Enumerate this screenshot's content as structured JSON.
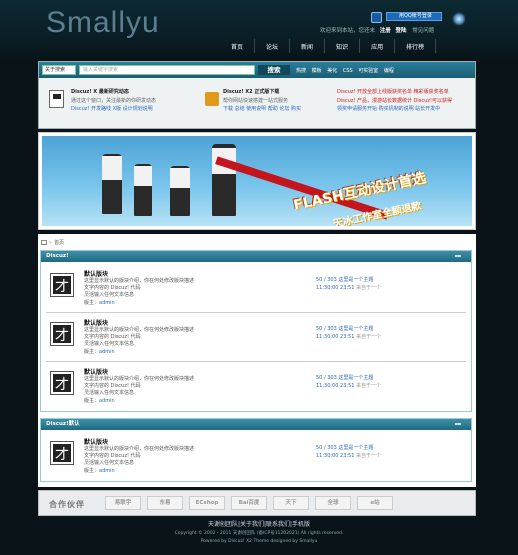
{
  "site": {
    "logo": "Smallyu"
  },
  "userbar": {
    "welcome": "欢迎来到本站，您还未",
    "register": "注册",
    "login": "登陆",
    "faq": "常见问题"
  },
  "qq_login_label": "用QQ帐号登录",
  "nav": [
    "首页",
    "论坛",
    "新闻",
    "知识",
    "应用",
    "排行榜"
  ],
  "search": {
    "scope": "关于搜索",
    "placeholder": "输入关键字搜索",
    "button": "搜索",
    "hot_words": [
      "热搜",
      "模板",
      "美化",
      "CSS",
      "可实验室",
      "编程"
    ]
  },
  "news": {
    "col1": {
      "title": "Discuz! X 最新研究动态",
      "line2": "通过这个窗口，关注最新的你研发动态",
      "line3": "Discuz! 开发路线 X版  设计规划说明"
    },
    "col2": {
      "title": "Discuz! X2 正式版下载",
      "line2": "帮你网站快速搭建一站式服务",
      "line3": "下载  总结  使用说明  帮助  论坛  购买"
    },
    "col3": {
      "line1": "Discuz! 开放全部上线版获奖名单  精彩版获奖名单",
      "line2": "Discuz! 产品，漫游站长数据统计  Discuz!可以获得",
      "line3": "领奖申请服务开始  购买机制的说明  站长开发中"
    }
  },
  "banner": {
    "headline": "FLASH互动设计首选",
    "subline": "天冰工作室全额退款"
  },
  "breadcrumb": {
    "arrow": "»",
    "home": "首页"
  },
  "sections": [
    {
      "title": "Discuz!",
      "forums": [
        {
          "name": "默认版块",
          "desc1": "这里显示默认的版块介绍，你在何处修改版块描述",
          "desc2": "文字内容的 Discuz! 代码",
          "desc3": "灵活输入任何文本信息",
          "mod_label": "版主：",
          "mod": "admin",
          "stats": "50 / 303 ",
          "stats_link": "这里是一个主题",
          "time": "11:30:00 23:51 ",
          "time_by": "来自于一个",
          "time_by2": ""
        },
        {
          "name": "默认版块",
          "desc1": "这里显示默认的版块介绍，你在何处修改版块描述",
          "desc2": "文字内容的 Discuz! 代码",
          "desc3": "灵活输入任何文本信息",
          "mod_label": "版主：",
          "mod": "admin",
          "stats": "50 / 303 ",
          "stats_link": "这里是一个主题",
          "time": "11:30:00 23:51 ",
          "time_by": "来自于一个",
          "time_by2": ""
        },
        {
          "name": "默认版块",
          "desc1": "这里显示默认的版块介绍，你在何处修改版块描述",
          "desc2": "文字内容的 Discuz! 代码",
          "desc3": "灵活输入任何文本信息",
          "mod_label": "版主：",
          "mod": "admin",
          "stats": "50 / 303 ",
          "stats_link": "这里是一个主题",
          "time": "11:30:00 23:51 ",
          "time_by": "来自于一个",
          "time_by2": ""
        }
      ]
    },
    {
      "title": "Discuz!默认",
      "forums": [
        {
          "name": "默认版块",
          "desc1": "这里显示默认的版块介绍，你在何处修改版块描述",
          "desc2": "文字内容的 Discuz! 代码",
          "desc3": "灵活输入任何文本信息",
          "mod_label": "版主：",
          "mod": "admin",
          "stats": "50 / 303 ",
          "stats_link": "这里是一个主题",
          "time": "11:30:00 23:51 ",
          "time_by": "来自于一个",
          "time_by2": ""
        }
      ]
    }
  ],
  "partner": {
    "title": "合作伙伴",
    "logos": [
      "易联宇",
      "东易",
      "ECshop",
      "Bai百度",
      "天下",
      "全球",
      "e站"
    ]
  },
  "footer": {
    "links": "天谢创团队|关于我们|联系我们|手机版",
    "copyright": "Copyright © 2002 - 2011 天谢创团队 (备ICP号11202021) All rights reserved.",
    "powered": "Powered by Discuz! X2  Theme designed by Smallyu"
  }
}
